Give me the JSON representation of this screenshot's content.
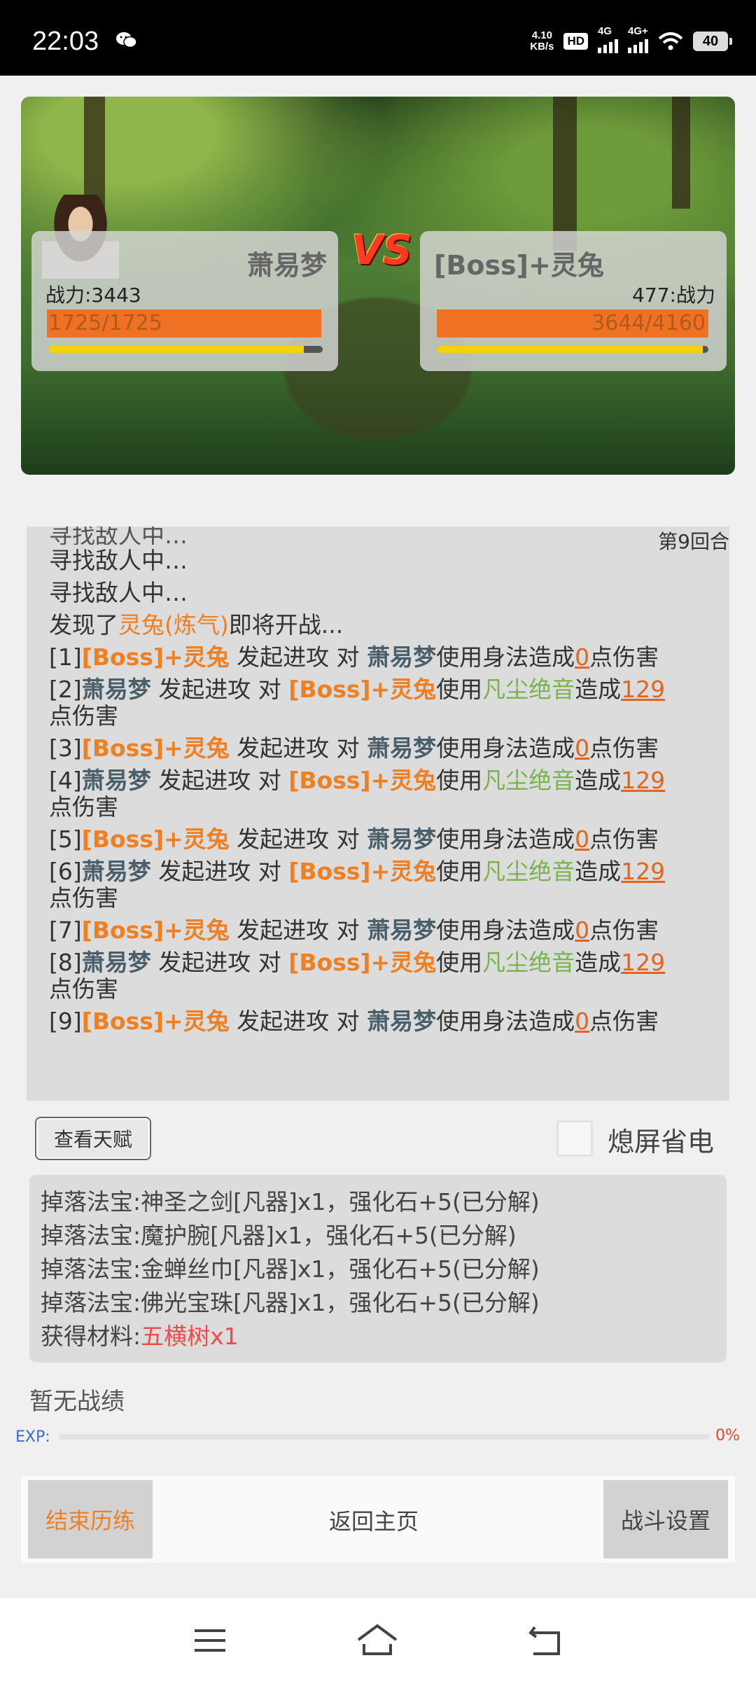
{
  "status_bar": {
    "time": "22:03",
    "net_speed_value": "4.10",
    "net_speed_unit": "KB/s",
    "hd_label": "HD",
    "signal1_label": "4G",
    "signal2_label": "4G+",
    "battery": "40"
  },
  "battle": {
    "player": {
      "name": "萧易梦",
      "power_text": "战力:3443",
      "hp_text": "1725/1725",
      "hp_fraction": 1.0,
      "energy_fraction": 0.93
    },
    "vs_label": "VS",
    "enemy": {
      "name": "[Boss]+灵兔",
      "power_text": "477:战力",
      "hp_text": "3644/4160",
      "hp_fraction": 0.876,
      "energy_fraction": 0.98
    }
  },
  "log": {
    "round_label": "第9回合",
    "cut_line": "寻找敌人中…",
    "searching": [
      "寻找敌人中…",
      "寻找敌人中…"
    ],
    "found": {
      "prefix": "发现了",
      "enemy": "灵兔(炼气)",
      "suffix": "即将开战..."
    },
    "common": {
      "player": "萧易梦",
      "enemy": "[Boss]+灵兔",
      "attack": " 发起进攻 对",
      "use": "使用",
      "movement": "使用身法造成",
      "skill": "凡尘绝音",
      "cause": "造成",
      "damage_unit": "点伤害"
    },
    "entries": [
      {
        "idx": "[1]",
        "dmg": "0"
      },
      {
        "idx": "[2]",
        "dmg": "129"
      },
      {
        "idx": "[3]",
        "dmg": "0"
      },
      {
        "idx": "[4]",
        "dmg": "129"
      },
      {
        "idx": "[5]",
        "dmg": "0"
      },
      {
        "idx": "[6]",
        "dmg": "129"
      },
      {
        "idx": "[7]",
        "dmg": "0"
      },
      {
        "idx": "[8]",
        "dmg": "129"
      },
      {
        "idx": "[9]",
        "dmg": "0"
      }
    ]
  },
  "controls": {
    "talent_button": "查看天赋",
    "screen_off_label": "熄屏省电"
  },
  "drops": {
    "lines": [
      "掉落法宝:神圣之剑[凡器]x1，强化石+5(已分解)",
      "掉落法宝:魔护腕[凡器]x1，强化石+5(已分解)",
      "掉落法宝:金蝉丝巾[凡器]x1，强化石+5(已分解)",
      "掉落法宝:佛光宝珠[凡器]x1，强化石+5(已分解)"
    ],
    "material_prefix": "获得材料:",
    "material_item": "五横树x1"
  },
  "record_text": "暂无战绩",
  "exp": {
    "label": "EXP:",
    "percent_text": "0%",
    "fraction": 0.0
  },
  "bottom_bar": {
    "end": "结束历练",
    "home": "返回主页",
    "settings": "战斗设置"
  },
  "colors": {
    "accent_orange": "#f07f22",
    "skill_green": "#7ab34c",
    "player_slate": "#4b5f6b",
    "hp_orange": "#ee7124",
    "energy_yellow": "#f2d20c"
  },
  "nav_icons": [
    "menu-icon",
    "home-icon",
    "back-icon"
  ]
}
